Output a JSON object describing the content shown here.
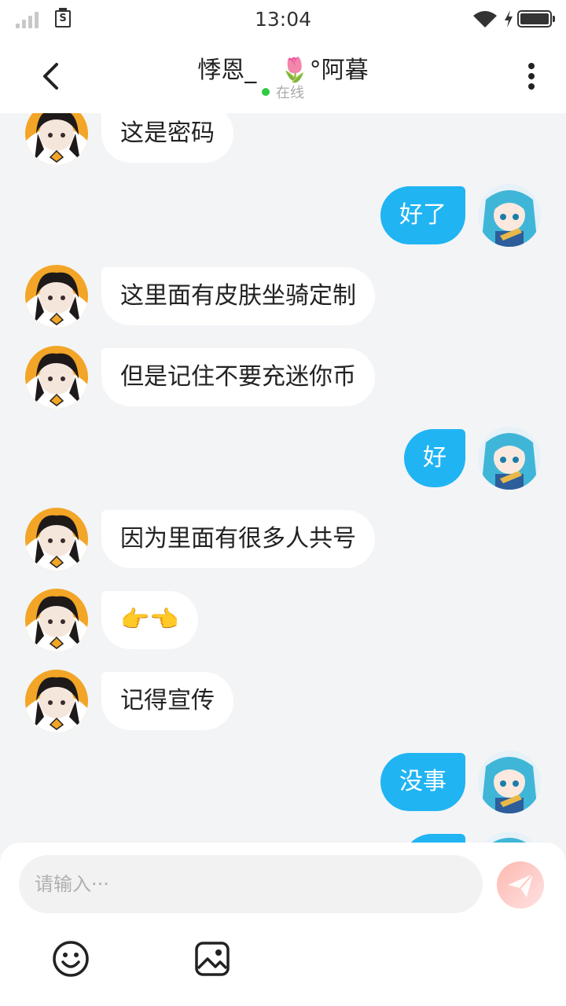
{
  "status_bar": {
    "time": "13:04",
    "sim_label": "S"
  },
  "header": {
    "title": "悸恩_　🌷°阿暮",
    "online_status": "在线"
  },
  "messages": [
    {
      "side": "left",
      "text": "这是密码"
    },
    {
      "side": "right",
      "text": "好了"
    },
    {
      "side": "left",
      "text": "这里面有皮肤坐骑定制"
    },
    {
      "side": "left",
      "text": "但是记住不要充迷你币"
    },
    {
      "side": "right",
      "text": "好"
    },
    {
      "side": "left",
      "text": "因为里面有很多人共号"
    },
    {
      "side": "left",
      "text": "👉👈"
    },
    {
      "side": "left",
      "text": "记得宣传"
    },
    {
      "side": "right",
      "text": "没事"
    },
    {
      "side": "right",
      "text": ""
    }
  ],
  "input": {
    "placeholder": "请输入···",
    "value": ""
  },
  "icons": {
    "back": "chevron-left-icon",
    "more": "more-vertical-icon",
    "send": "send-icon",
    "emoji": "smiley-icon",
    "image": "image-icon"
  },
  "colors": {
    "outgoing_bubble": "#20b4f3",
    "incoming_bubble": "#ffffff",
    "background": "#f3f4f6",
    "online_dot": "#2ecc40"
  }
}
